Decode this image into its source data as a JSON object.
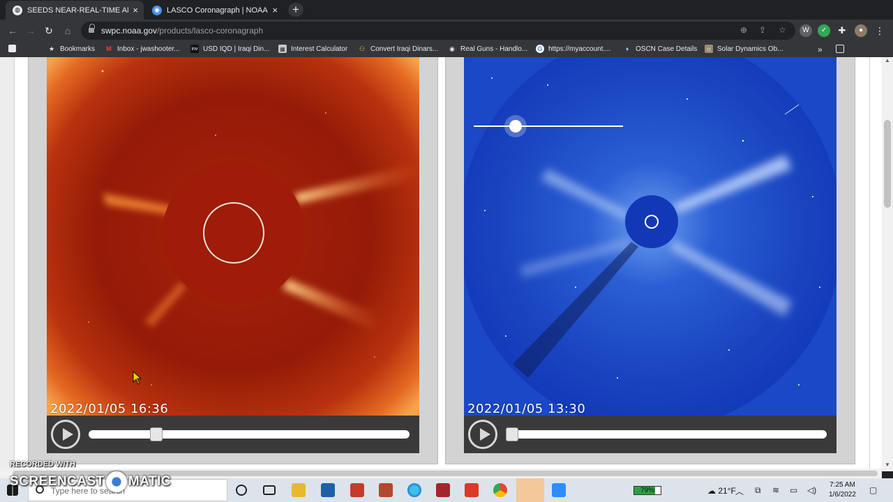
{
  "browser": {
    "tabs": [
      {
        "title": "SEEDS NEAR-REAL-TIME AND BE",
        "active": true
      },
      {
        "title": "LASCO Coronagraph | NOAA / N",
        "active": false
      }
    ],
    "close_glyph": "×",
    "new_tab_glyph": "+",
    "url_host": "swpc.noaa.gov",
    "url_path": "/products/lasco-coronagraph",
    "bookmarks": [
      {
        "label": "Bookmarks",
        "icon": "star-icon"
      },
      {
        "label": "Inbox - jwashooter...",
        "icon": "gmail-icon"
      },
      {
        "label": "USD IQD | Iraqi Din...",
        "icon": "inv-icon"
      },
      {
        "label": "Interest Calculator",
        "icon": "calculator-icon"
      },
      {
        "label": "Convert Iraqi Dinars...",
        "icon": "convert-icon"
      },
      {
        "label": "Real Guns - Handlo...",
        "icon": "gun-icon"
      },
      {
        "label": "https://myaccount....",
        "icon": "google-icon"
      },
      {
        "label": "OSCN Case Details",
        "icon": "oscn-icon"
      },
      {
        "label": "Solar Dynamics Ob...",
        "icon": "sdo-icon"
      }
    ],
    "more_bookmarks_glyph": "»"
  },
  "panels": [
    {
      "name": "c2",
      "timestamp": "2022/01/05  16:36",
      "progress": 0.2,
      "theme": "red"
    },
    {
      "name": "c3",
      "timestamp": "2022/01/05  13:30",
      "progress": 0.0,
      "theme": "blue"
    }
  ],
  "taskbar": {
    "search_placeholder": "Type here to search",
    "battery": "79%",
    "weather": "21°F",
    "time": "7:25 AM",
    "date": "1/6/2022"
  },
  "watermark": {
    "recorded_with": "RECORDED WITH",
    "brand_left": "SCREENCAST",
    "brand_right": "MATIC"
  },
  "colors": {
    "c2_base": "#9e1c08",
    "c3_base": "#1238b8",
    "panel_frame": "#d3d3d3"
  }
}
